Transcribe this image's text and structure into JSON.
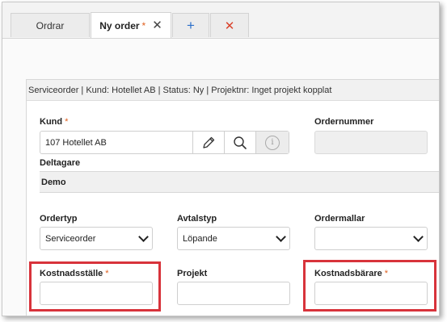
{
  "tabs": [
    {
      "label": "Ordrar"
    },
    {
      "label": "Ny order",
      "required_mark": "*",
      "close_glyph": "✕"
    },
    {
      "glyph": "+"
    },
    {
      "glyph": "✕"
    }
  ],
  "summary": "Serviceorder | Kund: Hotellet AB | Status: Ny | Projektnr: Inget projekt kopplat",
  "form": {
    "kund_label": "Kund",
    "kund_value": "107 Hotellet AB",
    "ordernummer_label": "Ordernummer",
    "ordernummer_value": "",
    "deltagare_label": "Deltagare",
    "deltagare_value": "Demo",
    "ordertyp_label": "Ordertyp",
    "ordertyp_value": "Serviceorder",
    "avtalstyp_label": "Avtalstyp",
    "avtalstyp_value": "Löpande",
    "ordermallar_label": "Ordermallar",
    "ordermallar_value": "",
    "kostnadsstalle_label": "Kostnadsställe",
    "kostnadsstalle_value": "",
    "projekt_label": "Projekt",
    "projekt_value": "",
    "kostnadsbarare_label": "Kostnadsbärare",
    "kostnadsbarare_value": "",
    "required_mark": "*",
    "info_glyph": "i"
  },
  "colors": {
    "required": "#e0601f",
    "highlight": "#d8333b",
    "add": "#2b6fc9",
    "close_all": "#d9422b"
  }
}
